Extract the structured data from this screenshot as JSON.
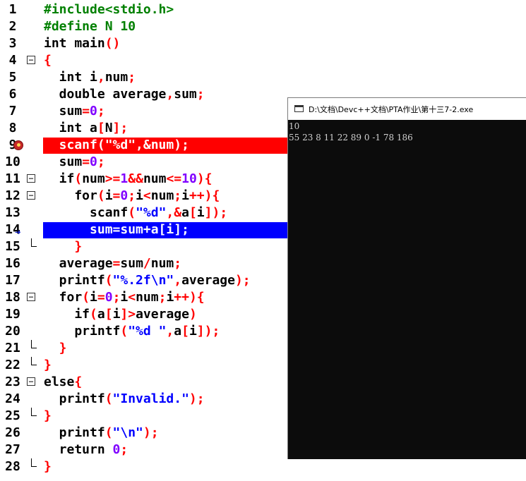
{
  "editor": {
    "lines": [
      {
        "n": "1",
        "tokens": [
          {
            "t": "#include<stdio.h>",
            "c": "#008000"
          }
        ]
      },
      {
        "n": "2",
        "tokens": [
          {
            "t": "#define N 10",
            "c": "#008000"
          }
        ]
      },
      {
        "n": "3",
        "tokens": [
          {
            "t": "int main",
            "c": "#000000"
          },
          {
            "t": "()",
            "c": "#ff0000"
          }
        ]
      },
      {
        "n": "4",
        "fold": "open",
        "tokens": [
          {
            "t": "{",
            "c": "#ff0000"
          }
        ]
      },
      {
        "n": "5",
        "tokens": [
          {
            "t": "  int i",
            "c": "#000000"
          },
          {
            "t": ",",
            "c": "#ff0000"
          },
          {
            "t": "num",
            "c": "#000000"
          },
          {
            "t": ";",
            "c": "#ff0000"
          }
        ]
      },
      {
        "n": "6",
        "tokens": [
          {
            "t": "  double average",
            "c": "#000000"
          },
          {
            "t": ",",
            "c": "#ff0000"
          },
          {
            "t": "sum",
            "c": "#000000"
          },
          {
            "t": ";",
            "c": "#ff0000"
          }
        ]
      },
      {
        "n": "7",
        "tokens": [
          {
            "t": "  sum",
            "c": "#000000"
          },
          {
            "t": "=",
            "c": "#ff0000"
          },
          {
            "t": "0",
            "c": "#8000ff"
          },
          {
            "t": ";",
            "c": "#ff0000"
          }
        ]
      },
      {
        "n": "8",
        "tokens": [
          {
            "t": "  int a",
            "c": "#000000"
          },
          {
            "t": "[",
            "c": "#ff0000"
          },
          {
            "t": "N",
            "c": "#000000"
          },
          {
            "t": "];",
            "c": "#ff0000"
          }
        ]
      },
      {
        "n": "9",
        "highlight": "breakpoint",
        "tokens": [
          {
            "t": "  scanf(\"%d\",&num);",
            "c": "#ffffff"
          }
        ]
      },
      {
        "n": "10",
        "tokens": [
          {
            "t": "  sum",
            "c": "#000000"
          },
          {
            "t": "=",
            "c": "#ff0000"
          },
          {
            "t": "0",
            "c": "#8000ff"
          },
          {
            "t": ";",
            "c": "#ff0000"
          }
        ]
      },
      {
        "n": "11",
        "fold": "open",
        "tokens": [
          {
            "t": "  if",
            "c": "#000000"
          },
          {
            "t": "(",
            "c": "#ff0000"
          },
          {
            "t": "num",
            "c": "#000000"
          },
          {
            "t": ">=",
            "c": "#ff0000"
          },
          {
            "t": "1",
            "c": "#8000ff"
          },
          {
            "t": "&&",
            "c": "#ff0000"
          },
          {
            "t": "num",
            "c": "#000000"
          },
          {
            "t": "<=",
            "c": "#ff0000"
          },
          {
            "t": "10",
            "c": "#8000ff"
          },
          {
            "t": "){",
            "c": "#ff0000"
          }
        ]
      },
      {
        "n": "12",
        "fold": "open",
        "tokens": [
          {
            "t": "    for",
            "c": "#000000"
          },
          {
            "t": "(",
            "c": "#ff0000"
          },
          {
            "t": "i",
            "c": "#000000"
          },
          {
            "t": "=",
            "c": "#ff0000"
          },
          {
            "t": "0",
            "c": "#8000ff"
          },
          {
            "t": ";",
            "c": "#ff0000"
          },
          {
            "t": "i",
            "c": "#000000"
          },
          {
            "t": "<",
            "c": "#ff0000"
          },
          {
            "t": "num",
            "c": "#000000"
          },
          {
            "t": ";",
            "c": "#ff0000"
          },
          {
            "t": "i",
            "c": "#000000"
          },
          {
            "t": "++){",
            "c": "#ff0000"
          }
        ]
      },
      {
        "n": "13",
        "tokens": [
          {
            "t": "      scanf",
            "c": "#000000"
          },
          {
            "t": "(",
            "c": "#ff0000"
          },
          {
            "t": "\"%d\"",
            "c": "#0000ff"
          },
          {
            "t": ",&",
            "c": "#ff0000"
          },
          {
            "t": "a",
            "c": "#000000"
          },
          {
            "t": "[",
            "c": "#ff0000"
          },
          {
            "t": "i",
            "c": "#000000"
          },
          {
            "t": "]);",
            "c": "#ff0000"
          }
        ]
      },
      {
        "n": "14",
        "highlight": "exec",
        "tokens": [
          {
            "t": "      sum=sum+a[i];",
            "c": "#ffffff"
          }
        ]
      },
      {
        "n": "15",
        "fold": "end",
        "tokens": [
          {
            "t": "    }",
            "c": "#ff0000"
          }
        ]
      },
      {
        "n": "16",
        "tokens": [
          {
            "t": "  average",
            "c": "#000000"
          },
          {
            "t": "=",
            "c": "#ff0000"
          },
          {
            "t": "sum",
            "c": "#000000"
          },
          {
            "t": "/",
            "c": "#ff0000"
          },
          {
            "t": "num",
            "c": "#000000"
          },
          {
            "t": ";",
            "c": "#ff0000"
          }
        ]
      },
      {
        "n": "17",
        "tokens": [
          {
            "t": "  printf",
            "c": "#000000"
          },
          {
            "t": "(",
            "c": "#ff0000"
          },
          {
            "t": "\"%.2f\\n\"",
            "c": "#0000ff"
          },
          {
            "t": ",",
            "c": "#ff0000"
          },
          {
            "t": "average",
            "c": "#000000"
          },
          {
            "t": ");",
            "c": "#ff0000"
          }
        ]
      },
      {
        "n": "18",
        "fold": "open",
        "tokens": [
          {
            "t": "  for",
            "c": "#000000"
          },
          {
            "t": "(",
            "c": "#ff0000"
          },
          {
            "t": "i",
            "c": "#000000"
          },
          {
            "t": "=",
            "c": "#ff0000"
          },
          {
            "t": "0",
            "c": "#8000ff"
          },
          {
            "t": ";",
            "c": "#ff0000"
          },
          {
            "t": "i",
            "c": "#000000"
          },
          {
            "t": "<",
            "c": "#ff0000"
          },
          {
            "t": "num",
            "c": "#000000"
          },
          {
            "t": ";",
            "c": "#ff0000"
          },
          {
            "t": "i",
            "c": "#000000"
          },
          {
            "t": "++){",
            "c": "#ff0000"
          }
        ]
      },
      {
        "n": "19",
        "tokens": [
          {
            "t": "    if",
            "c": "#000000"
          },
          {
            "t": "(",
            "c": "#ff0000"
          },
          {
            "t": "a",
            "c": "#000000"
          },
          {
            "t": "[",
            "c": "#ff0000"
          },
          {
            "t": "i",
            "c": "#000000"
          },
          {
            "t": "]>",
            "c": "#ff0000"
          },
          {
            "t": "average",
            "c": "#000000"
          },
          {
            "t": ")",
            "c": "#ff0000"
          }
        ]
      },
      {
        "n": "20",
        "tokens": [
          {
            "t": "    printf",
            "c": "#000000"
          },
          {
            "t": "(",
            "c": "#ff0000"
          },
          {
            "t": "\"%d \"",
            "c": "#0000ff"
          },
          {
            "t": ",",
            "c": "#ff0000"
          },
          {
            "t": "a",
            "c": "#000000"
          },
          {
            "t": "[",
            "c": "#ff0000"
          },
          {
            "t": "i",
            "c": "#000000"
          },
          {
            "t": "]);",
            "c": "#ff0000"
          }
        ]
      },
      {
        "n": "21",
        "fold": "end",
        "tokens": [
          {
            "t": "  }",
            "c": "#ff0000"
          }
        ]
      },
      {
        "n": "22",
        "fold": "end",
        "tokens": [
          {
            "t": "}",
            "c": "#ff0000"
          }
        ]
      },
      {
        "n": "23",
        "fold": "open",
        "tokens": [
          {
            "t": "else",
            "c": "#000000"
          },
          {
            "t": "{",
            "c": "#ff0000"
          }
        ]
      },
      {
        "n": "24",
        "tokens": [
          {
            "t": "  printf",
            "c": "#000000"
          },
          {
            "t": "(",
            "c": "#ff0000"
          },
          {
            "t": "\"Invalid.\"",
            "c": "#0000ff"
          },
          {
            "t": ");",
            "c": "#ff0000"
          }
        ]
      },
      {
        "n": "25",
        "fold": "end",
        "tokens": [
          {
            "t": "}",
            "c": "#ff0000"
          }
        ]
      },
      {
        "n": "26",
        "tokens": [
          {
            "t": "  printf",
            "c": "#000000"
          },
          {
            "t": "(",
            "c": "#ff0000"
          },
          {
            "t": "\"\\n\"",
            "c": "#0000ff"
          },
          {
            "t": ");",
            "c": "#ff0000"
          }
        ]
      },
      {
        "n": "27",
        "tokens": [
          {
            "t": "  return ",
            "c": "#000000"
          },
          {
            "t": "0",
            "c": "#8000ff"
          },
          {
            "t": ";",
            "c": "#ff0000"
          }
        ]
      },
      {
        "n": "28",
        "fold": "end",
        "tokens": [
          {
            "t": "}",
            "c": "#ff0000"
          }
        ]
      }
    ]
  },
  "console": {
    "title": "D:\\文档\\Devc++文档\\PTA作业\\第十三7-2.exe",
    "output": [
      "10",
      "55 23 8 11 22 89 0 -1 78 186"
    ]
  },
  "colors": {
    "breakpoint_bg": "#ff0000",
    "exec_bg": "#0000ff",
    "console_bg": "#0c0c0c",
    "console_fg": "#d0d0d0"
  }
}
